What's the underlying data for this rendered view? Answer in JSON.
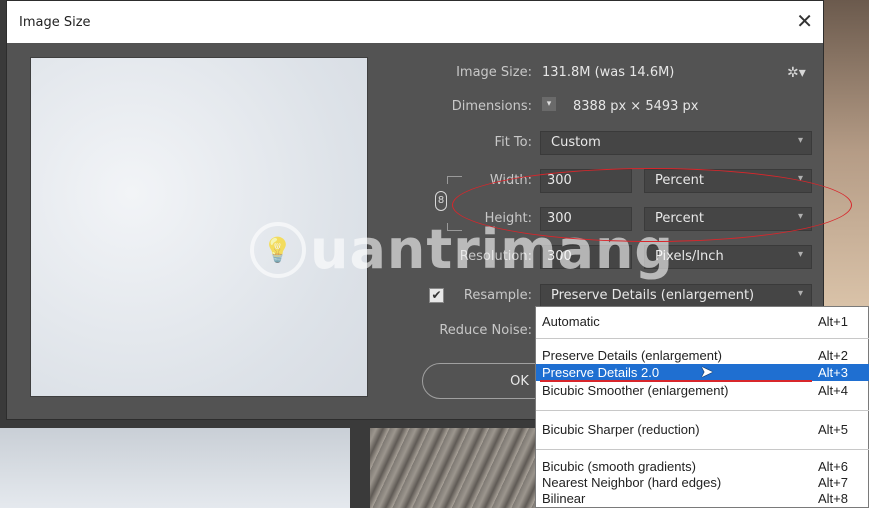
{
  "dialog": {
    "title": "Image Size"
  },
  "info": {
    "image_size_label": "Image Size:",
    "image_size_value": "131.8M (was 14.6M)",
    "dimensions_label": "Dimensions:",
    "dimensions_value": "8388 px  ×  5493 px",
    "fit_to_label": "Fit To:",
    "fit_to_value": "Custom",
    "width_label": "Width:",
    "width_value": "300",
    "width_unit": "Percent",
    "height_label": "Height:",
    "height_value": "300",
    "height_unit": "Percent",
    "resolution_label": "Resolution:",
    "resolution_value": "300",
    "resolution_unit": "Pixels/Inch",
    "resample_label": "Resample:",
    "resample_value": "Preserve Details (enlargement)",
    "reduce_noise_label": "Reduce Noise:"
  },
  "buttons": {
    "ok": "OK"
  },
  "watermark": {
    "text": "uantrimang",
    "icon": "lightbulb-icon"
  },
  "menu": {
    "items": [
      {
        "label": "Automatic",
        "shortcut": "Alt+1"
      },
      {
        "label": "Preserve Details (enlargement)",
        "shortcut": "Alt+2"
      },
      {
        "label": "Preserve Details 2.0",
        "shortcut": "Alt+3"
      },
      {
        "label": "Bicubic Smoother (enlargement)",
        "shortcut": "Alt+4"
      },
      {
        "label": "Bicubic Sharper (reduction)",
        "shortcut": "Alt+5"
      },
      {
        "label": "Bicubic (smooth gradients)",
        "shortcut": "Alt+6"
      },
      {
        "label": "Nearest Neighbor (hard edges)",
        "shortcut": "Alt+7"
      },
      {
        "label": "Bilinear",
        "shortcut": "Alt+8"
      }
    ],
    "selected_index": 2
  },
  "colors": {
    "dialog_bg": "#535353",
    "highlight": "#1f6fd1",
    "annotation_red": "#d8262b"
  }
}
